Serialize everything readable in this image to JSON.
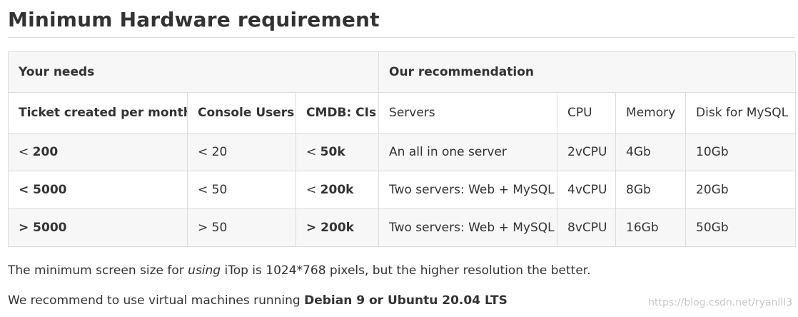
{
  "title": "Minimum Hardware requirement",
  "table": {
    "group_headers": {
      "needs": "Your needs",
      "recommendation": "Our recommendation"
    },
    "columns": [
      "Ticket created per month",
      "Console Users",
      "CMDB: CIs",
      "Servers",
      "CPU",
      "Memory",
      "Disk for MySQL"
    ],
    "rows": [
      {
        "tickets_op": "<",
        "tickets_val": "200",
        "users": "< 20",
        "cis_op": "<",
        "cis_val": "50k",
        "servers": "An all in one server",
        "cpu": "2vCPU",
        "memory": "4Gb",
        "disk": "10Gb"
      },
      {
        "tickets_op": "<",
        "tickets_val": "5000",
        "users": "< 50",
        "cis_op": "<",
        "cis_val": "200k",
        "servers": "Two servers: Web + MySQL",
        "cpu": "4vCPU",
        "memory": "8Gb",
        "disk": "20Gb"
      },
      {
        "tickets_op": ">",
        "tickets_val": "5000",
        "users": "> 50",
        "cis_op": ">",
        "cis_val": "200k",
        "servers": "Two servers: Web + MySQL",
        "cpu": "8vCPU",
        "memory": "16Gb",
        "disk": "50Gb"
      }
    ]
  },
  "footer": {
    "line1_pre": "The minimum screen size for ",
    "line1_em": "using",
    "line1_post": " iTop is 1024*768 pixels, but the higher resolution the better.",
    "line2_pre": "We recommend to use virtual machines running ",
    "line2_bold": "Debian 9 or Ubuntu 20.04 LTS"
  },
  "watermark": "https://blog.csdn.net/ryanlll3"
}
